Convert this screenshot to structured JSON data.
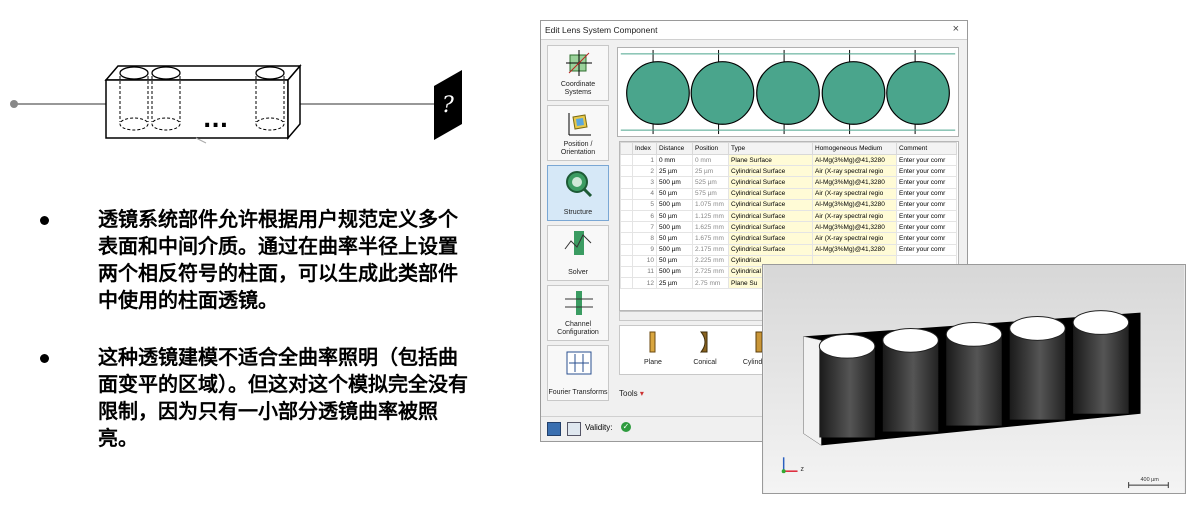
{
  "schematic": {
    "ellipsis": "...",
    "detector_symbol": "?"
  },
  "bullets": [
    {
      "text": "透镜系统部件允许根据用户规范定义多个表面和中间介质。通过在曲率半径上设置两个相反符号的柱面，可以生成此类部件中使用的柱面透镜。"
    },
    {
      "text": "这种透镜建模不适合全曲率照明（包括曲面变平的区域）。但这对这个模拟完全没有限制，因为只有一小部分透镜曲率被照亮。"
    }
  ],
  "dialog": {
    "title": "Edit Lens System Component",
    "close": "×",
    "nav": [
      {
        "label": "Coordinate Systems",
        "icon": "coordinate-systems-icon"
      },
      {
        "label": "Position / Orientation",
        "icon": "position-orientation-icon"
      },
      {
        "label": "Structure",
        "icon": "structure-icon",
        "active": true
      },
      {
        "label": "Solver",
        "icon": "solver-icon"
      },
      {
        "label": "Channel Configuration",
        "icon": "channel-configuration-icon"
      },
      {
        "label": "Fourier Transforms",
        "icon": "fourier-transforms-icon"
      }
    ],
    "table": {
      "headers": [
        "Index",
        "Distance",
        "Position",
        "Type",
        "Homogeneous Medium",
        "Comment"
      ],
      "rows": [
        [
          "1",
          "0 mm",
          "0 mm",
          "Plane Surface",
          "Al-Mg(3%Mg)@41,3280",
          "Enter your comr"
        ],
        [
          "2",
          "25 µm",
          "25 µm",
          "Cylindrical Surface",
          "Air (X-ray spectral regio",
          "Enter your comr"
        ],
        [
          "3",
          "500 µm",
          "525 µm",
          "Cylindrical Surface",
          "Al-Mg(3%Mg)@41,3280",
          "Enter your comr"
        ],
        [
          "4",
          "50 µm",
          "575 µm",
          "Cylindrical Surface",
          "Air (X-ray spectral regio",
          "Enter your comr"
        ],
        [
          "5",
          "500 µm",
          "1.075 mm",
          "Cylindrical Surface",
          "Al-Mg(3%Mg)@41,3280",
          "Enter your comr"
        ],
        [
          "6",
          "50 µm",
          "1.125 mm",
          "Cylindrical Surface",
          "Air (X-ray spectral regio",
          "Enter your comr"
        ],
        [
          "7",
          "500 µm",
          "1.625 mm",
          "Cylindrical Surface",
          "Al-Mg(3%Mg)@41,3280",
          "Enter your comr"
        ],
        [
          "8",
          "50 µm",
          "1.675 mm",
          "Cylindrical Surface",
          "Air (X-ray spectral regio",
          "Enter your comr"
        ],
        [
          "9",
          "500 µm",
          "2.175 mm",
          "Cylindrical Surface",
          "Al-Mg(3%Mg)@41,3280",
          "Enter your comr"
        ],
        [
          "10",
          "50 µm",
          "2.225 mm",
          "Cylindrical",
          "",
          ""
        ],
        [
          "11",
          "500 µm",
          "2.725 mm",
          "Cylindrical",
          "",
          ""
        ],
        [
          "12",
          "25 µm",
          "2.75 mm",
          "Plane Su",
          "",
          ""
        ]
      ]
    },
    "palette": [
      {
        "label": "Plane",
        "icon": "plane-surface-icon"
      },
      {
        "label": "Conical",
        "icon": "conical-surface-icon"
      },
      {
        "label": "Cylindrical",
        "icon": "cylindrical-surface-icon"
      }
    ],
    "tools_label": "Tools",
    "validity_label": "Validity:"
  },
  "render": {
    "scale_label": "400 µm",
    "axis_label": "z"
  },
  "colors": {
    "lens_green": "#4aa58c",
    "active_nav": "#d6e8f7",
    "medium_yellow": "#fffbd6"
  }
}
